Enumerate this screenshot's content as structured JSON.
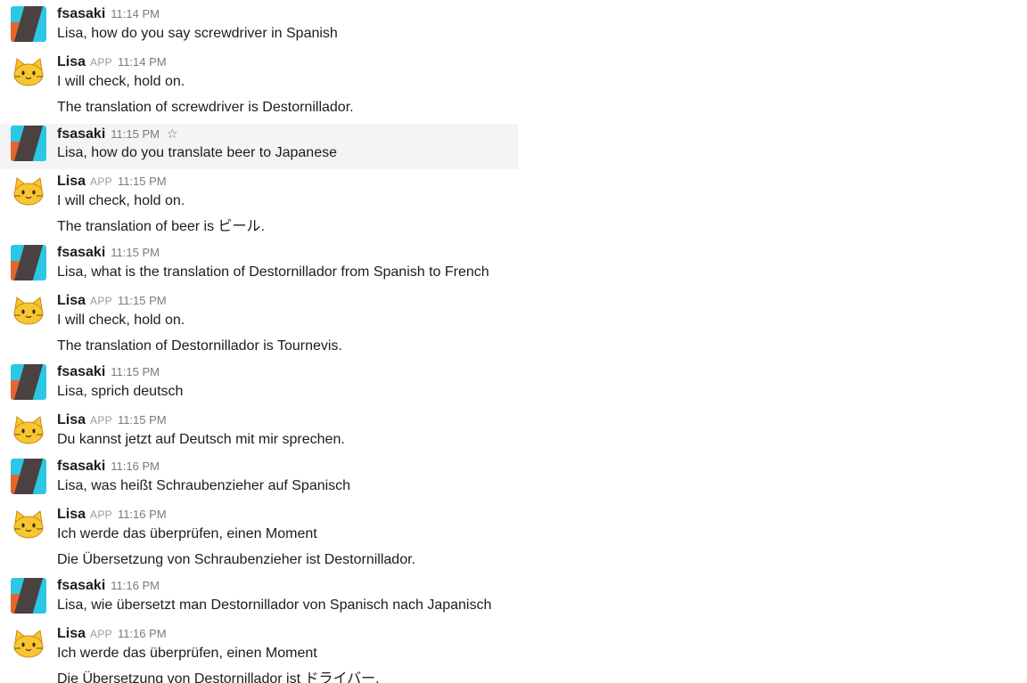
{
  "messages": [
    {
      "author": "fsasaki",
      "app": "",
      "time": "11:14 PM",
      "lines": [
        "Lisa, how do you say screwdriver in Spanish"
      ]
    },
    {
      "author": "Lisa",
      "app": "APP",
      "time": "11:14 PM",
      "lines": [
        "I will check, hold on.",
        "The translation of screwdriver is Destornillador."
      ]
    },
    {
      "author": "fsasaki",
      "app": "",
      "time": "11:15 PM",
      "lines": [
        "Lisa, how do you translate beer to Japanese"
      ],
      "star": "☆"
    },
    {
      "author": "Lisa",
      "app": "APP",
      "time": "11:15 PM",
      "lines": [
        "I will check, hold on.",
        "The translation of beer is ビール."
      ]
    },
    {
      "author": "fsasaki",
      "app": "",
      "time": "11:15 PM",
      "lines": [
        "Lisa, what is the translation of Destornillador from Spanish to French"
      ]
    },
    {
      "author": "Lisa",
      "app": "APP",
      "time": "11:15 PM",
      "lines": [
        "I will check, hold on.",
        "The translation of Destornillador is Tournevis."
      ]
    },
    {
      "author": "fsasaki",
      "app": "",
      "time": "11:15 PM",
      "lines": [
        "Lisa, sprich deutsch"
      ]
    },
    {
      "author": "Lisa",
      "app": "APP",
      "time": "11:15 PM",
      "lines": [
        "Du kannst jetzt auf Deutsch mit mir sprechen."
      ]
    },
    {
      "author": "fsasaki",
      "app": "",
      "time": "11:16 PM",
      "lines": [
        "Lisa, was heißt Schraubenzieher auf Spanisch"
      ]
    },
    {
      "author": "Lisa",
      "app": "APP",
      "time": "11:16 PM",
      "lines": [
        "Ich werde das überprüfen, einen Moment",
        "Die Übersetzung von Schraubenzieher ist Destornillador."
      ]
    },
    {
      "author": "fsasaki",
      "app": "",
      "time": "11:16 PM",
      "lines": [
        "Lisa, wie übersetzt man Destornillador von Spanisch nach Japanisch"
      ]
    },
    {
      "author": "Lisa",
      "app": "APP",
      "time": "11:16 PM",
      "lines": [
        "Ich werde das überprüfen, einen Moment",
        "Die Übersetzung von Destornillador ist ドライバー."
      ]
    }
  ],
  "colors": {
    "avatar_blue": "#2bc7e4",
    "avatar_orange": "#e4652d",
    "avatar_dark": "#4b4141",
    "cat_yellow": "#f7c631",
    "highlight_bg": "#f4f4f4"
  },
  "icons": {
    "user_avatar": "fsasaki-avatar-icon",
    "bot_avatar": "cat-face-icon",
    "star": "star-icon"
  }
}
